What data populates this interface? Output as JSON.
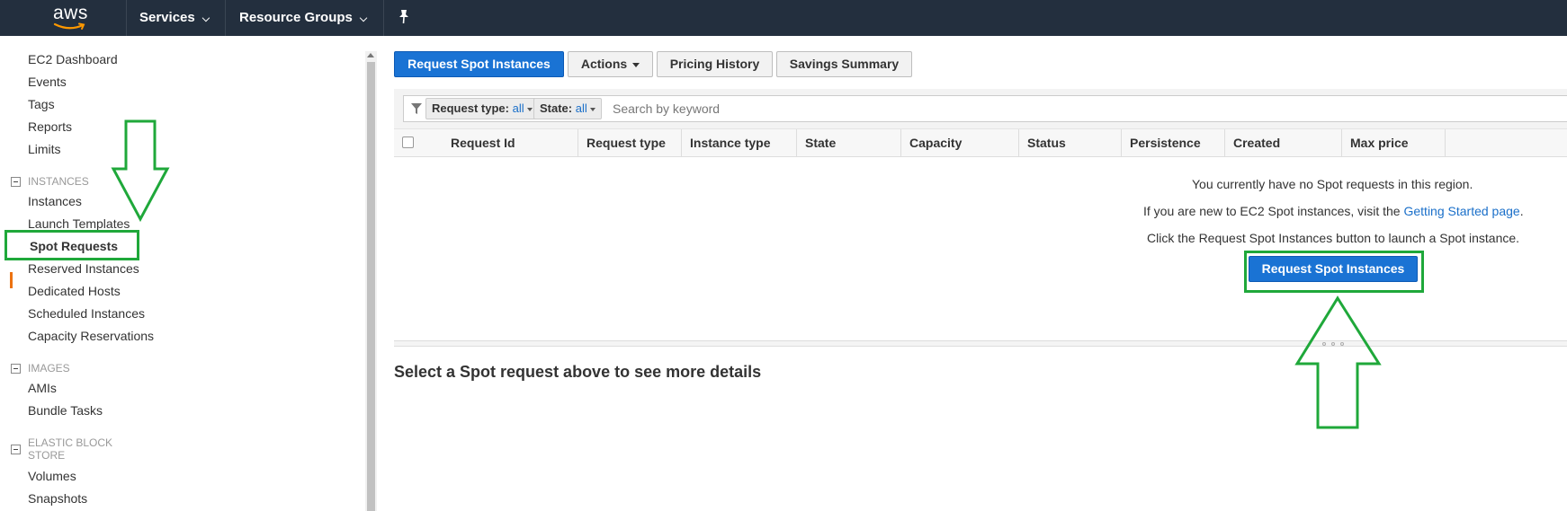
{
  "topnav": {
    "logo_text": "aws",
    "services_label": "Services",
    "resource_groups_label": "Resource Groups",
    "pin_icon": "pin-icon",
    "background": "#232f3e"
  },
  "sidebar": {
    "items_top": [
      "EC2 Dashboard",
      "Events",
      "Tags",
      "Reports",
      "Limits"
    ],
    "sections": [
      {
        "title": "INSTANCES",
        "items": [
          "Instances",
          "Launch Templates",
          "Spot Requests",
          "Reserved Instances",
          "Dedicated Hosts",
          "Scheduled Instances",
          "Capacity Reservations"
        ]
      },
      {
        "title": "IMAGES",
        "items": [
          "AMIs",
          "Bundle Tasks"
        ]
      },
      {
        "title": "ELASTIC BLOCK STORE",
        "items": [
          "Volumes",
          "Snapshots"
        ]
      }
    ],
    "active_item": "Spot Requests",
    "active_color": "#ec7211"
  },
  "toolbar": {
    "request_spot_label": "Request Spot Instances",
    "actions_label": "Actions",
    "pricing_history_label": "Pricing History",
    "savings_summary_label": "Savings Summary",
    "primary_color": "#1a73d4"
  },
  "filter": {
    "request_type_key": "Request type:",
    "request_type_value": "all",
    "state_key": "State:",
    "state_value": "all",
    "search_placeholder": "Search by keyword"
  },
  "table": {
    "columns": [
      "Request Id",
      "Request type",
      "Instance type",
      "State",
      "Capacity",
      "Status",
      "Persistence",
      "Created",
      "Max price"
    ]
  },
  "empty_state": {
    "line1": "You currently have no Spot requests in this region.",
    "line2_prefix": "If you are new to EC2 Spot instances, visit the ",
    "line2_link": "Getting Started page",
    "line2_suffix": ".",
    "line3": "Click the Request Spot Instances button to launch a Spot instance.",
    "button_label": "Request Spot Instances"
  },
  "details": {
    "heading": "Select a Spot request above to see more details"
  },
  "annotations": {
    "color": "#1fa83a"
  }
}
